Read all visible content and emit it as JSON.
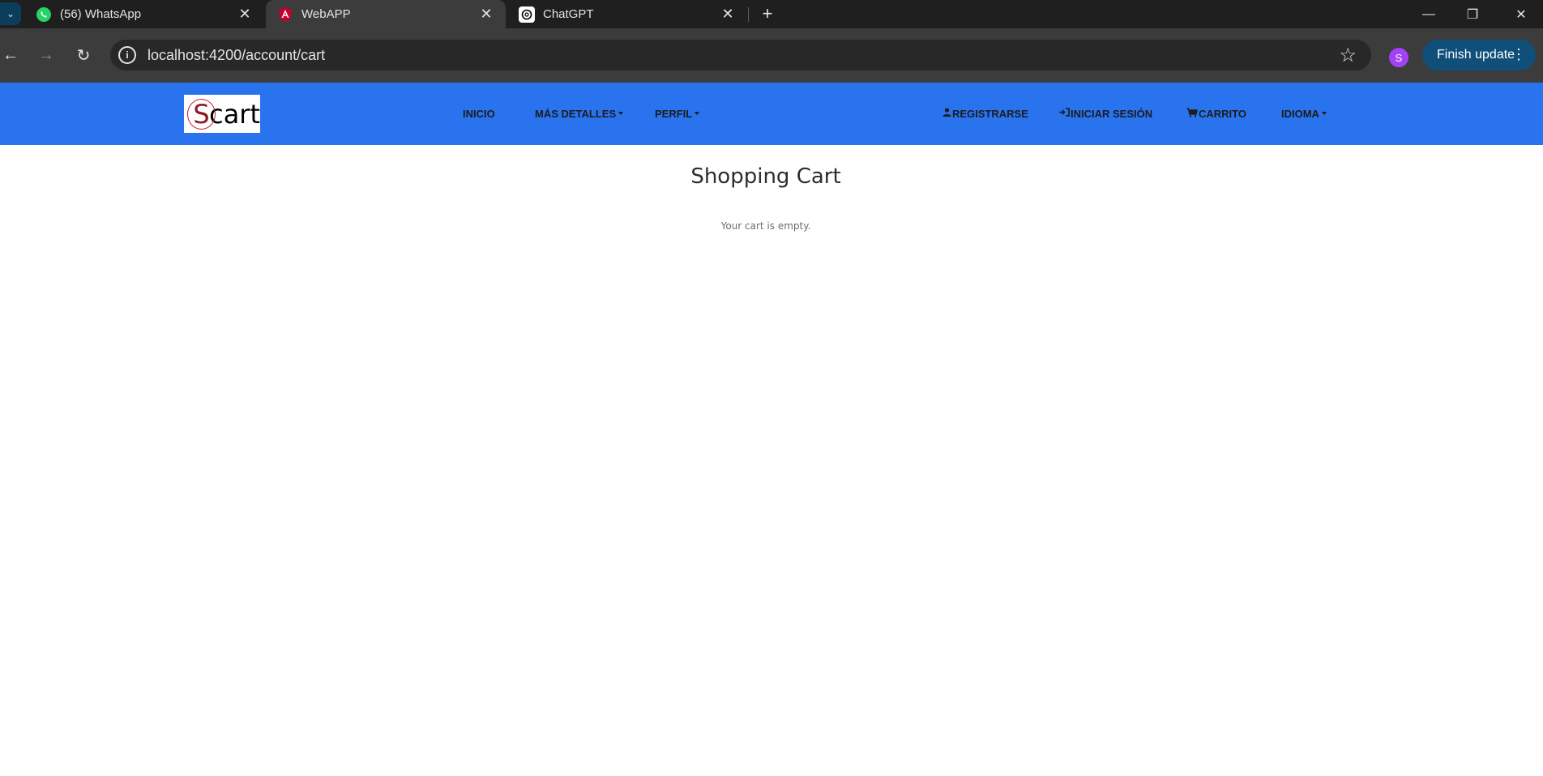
{
  "browser": {
    "tabs": [
      {
        "title": "(56) WhatsApp",
        "icon": "whatsapp-icon"
      },
      {
        "title": "WebAPP",
        "icon": "angular-icon"
      },
      {
        "title": "ChatGPT",
        "icon": "chatgpt-icon"
      }
    ],
    "url": "localhost:4200/account/cart",
    "profile_initial": "S",
    "update_label": "Finish update"
  },
  "site": {
    "logo_s": "S",
    "logo_rest": "cart",
    "nav": {
      "inicio": "INICIO",
      "mas_detalles": "MÁS DETALLES",
      "perfil": "PERFIL",
      "registrarse": "REGISTRARSE",
      "iniciar_sesion": "INICIAR SESIÓN",
      "carrito": "CARRITO",
      "idioma": "IDIOMA"
    },
    "colors": {
      "navbar": "#2a73ef"
    }
  },
  "page": {
    "title": "Shopping Cart",
    "empty_message": "Your cart is empty."
  }
}
